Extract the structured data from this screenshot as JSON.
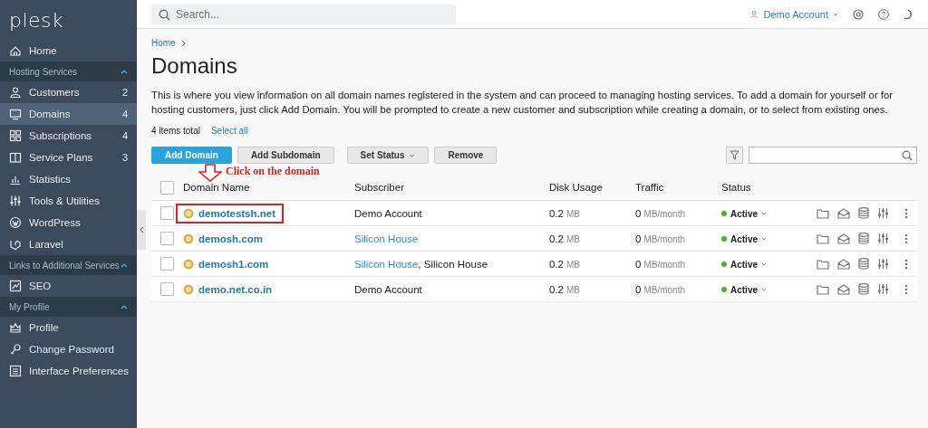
{
  "logo": "plesk",
  "sidebar": {
    "sections": [
      {
        "items": [
          {
            "label": "Home",
            "selected": false
          }
        ]
      },
      {
        "title": "Hosting Services",
        "expanded": true,
        "items": [
          {
            "label": "Customers",
            "count": "2",
            "selected": false
          },
          {
            "label": "Domains",
            "count": "4",
            "selected": true
          },
          {
            "label": "Subscriptions",
            "count": "4",
            "selected": false
          },
          {
            "label": "Service Plans",
            "count": "3",
            "selected": false
          },
          {
            "label": "Statistics",
            "selected": false
          },
          {
            "label": "Tools & Utilities",
            "selected": false
          },
          {
            "label": "WordPress",
            "selected": false
          },
          {
            "label": "Laravel",
            "selected": false
          }
        ]
      },
      {
        "title": "Links to Additional Services",
        "expanded": true,
        "items": [
          {
            "label": "SEO",
            "selected": false
          }
        ]
      },
      {
        "title": "My Profile",
        "expanded": true,
        "items": [
          {
            "label": "Profile",
            "selected": false
          },
          {
            "label": "Change Password",
            "selected": false
          },
          {
            "label": "Interface Preferences",
            "selected": false
          }
        ]
      }
    ]
  },
  "topbar": {
    "search": {
      "placeholder": "Search..."
    },
    "account": "Demo Account"
  },
  "breadcrumb": [
    "Home"
  ],
  "title": "Domains",
  "description": "This is where you view information on all domain names registered in the system and can proceed to managing hosting services. To add a domain for yourself or for hosting customers, just click Add Domain. You will be prompted to create a new customer and subscription while creating a domain, or to select from existing ones.",
  "summary": {
    "count": "4 items total",
    "select_all": "Select all"
  },
  "toolbar": {
    "buttons": [
      {
        "label": "Add Domain",
        "kind": "primary"
      },
      {
        "label": "Add Subdomain",
        "kind": "plain"
      },
      {
        "label": "Set Status",
        "kind": "dropdown"
      },
      {
        "label": "Remove",
        "kind": "plain"
      }
    ]
  },
  "table": {
    "columns": [
      "Domain Name",
      "Subscriber",
      "Disk Usage",
      "Traffic",
      "Status"
    ],
    "all_checked": false,
    "rows": [
      {
        "checked": false,
        "highlighted": true,
        "domain": "demotestsh.net",
        "subscriber": [
          {
            "kind": "text",
            "text": "Demo Account"
          }
        ],
        "disk": "0.2",
        "disk_unit": "MB",
        "traffic": "0",
        "traffic_unit": "MB/month",
        "status": "Active"
      },
      {
        "checked": false,
        "highlighted": false,
        "domain": "demosh.com",
        "subscriber": [
          {
            "kind": "link",
            "text": "Silicon House"
          }
        ],
        "disk": "0.2",
        "disk_unit": "MB",
        "traffic": "0",
        "traffic_unit": "MB/month",
        "status": "Active"
      },
      {
        "checked": false,
        "highlighted": false,
        "domain": "demosh1.com",
        "subscriber": [
          {
            "kind": "link",
            "text": "Silicon House"
          },
          {
            "kind": "text",
            "text": ", Silicon House"
          }
        ],
        "disk": "0.2",
        "disk_unit": "MB",
        "traffic": "0",
        "traffic_unit": "MB/month",
        "status": "Active"
      },
      {
        "checked": false,
        "highlighted": false,
        "domain": "demo.net.co.in",
        "subscriber": [
          {
            "kind": "text",
            "text": "Demo Account"
          }
        ],
        "disk": "0.2",
        "disk_unit": "MB",
        "traffic": "0",
        "traffic_unit": "MB/month",
        "status": "Active"
      }
    ]
  },
  "annotation": {
    "text": "Click on the domain"
  }
}
